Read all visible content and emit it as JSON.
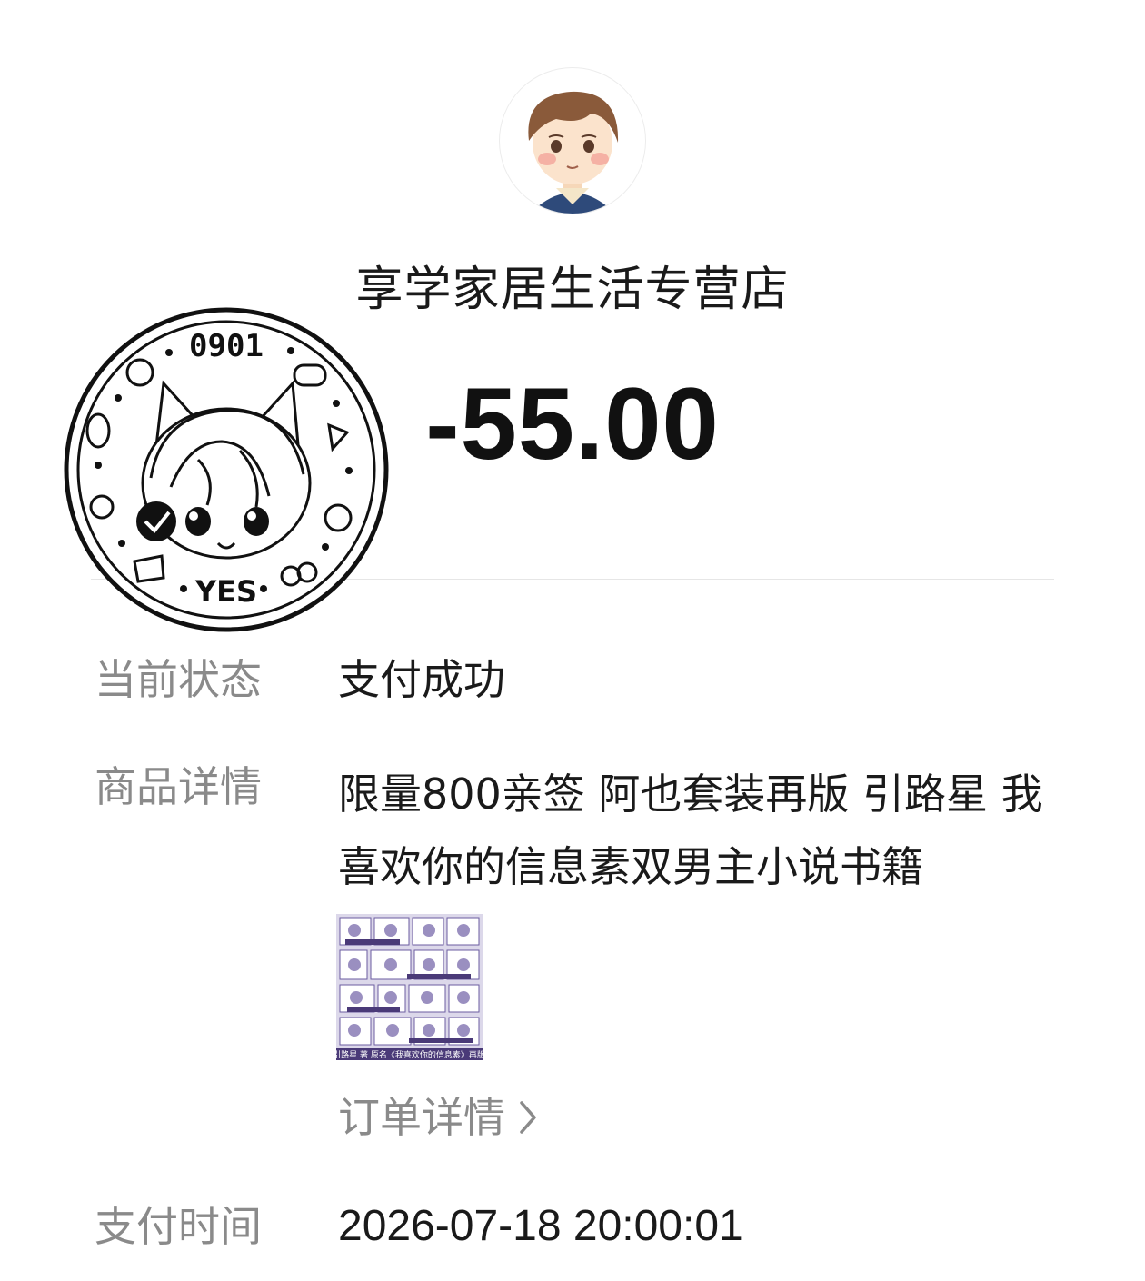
{
  "merchant": {
    "name": "享学家居生活专营店",
    "avatar_icon": "cartoon-boy-avatar-icon"
  },
  "payment": {
    "amount": "-55.00"
  },
  "stamp": {
    "icon": "yes-stamp-icon",
    "top_text": "0901",
    "bottom_text": "YES"
  },
  "details": {
    "status_label": "当前状态",
    "status_value": "支付成功",
    "product_label": "商品详情",
    "product_value": "限量800亲签 阿也套装再版 引路星 我喜欢你的信息素双男主小说书籍",
    "product_thumbnail_caption": "引路星 著 原名《我喜欢你的信息素》再版",
    "order_link_label": "订单详情",
    "time_label": "支付时间",
    "time_value": "2026-07-18 20:00:01"
  },
  "colors": {
    "label_gray": "#8a8a8a",
    "text_dark": "#1a1a1a",
    "thumbnail_purple": "#4a3a78"
  }
}
